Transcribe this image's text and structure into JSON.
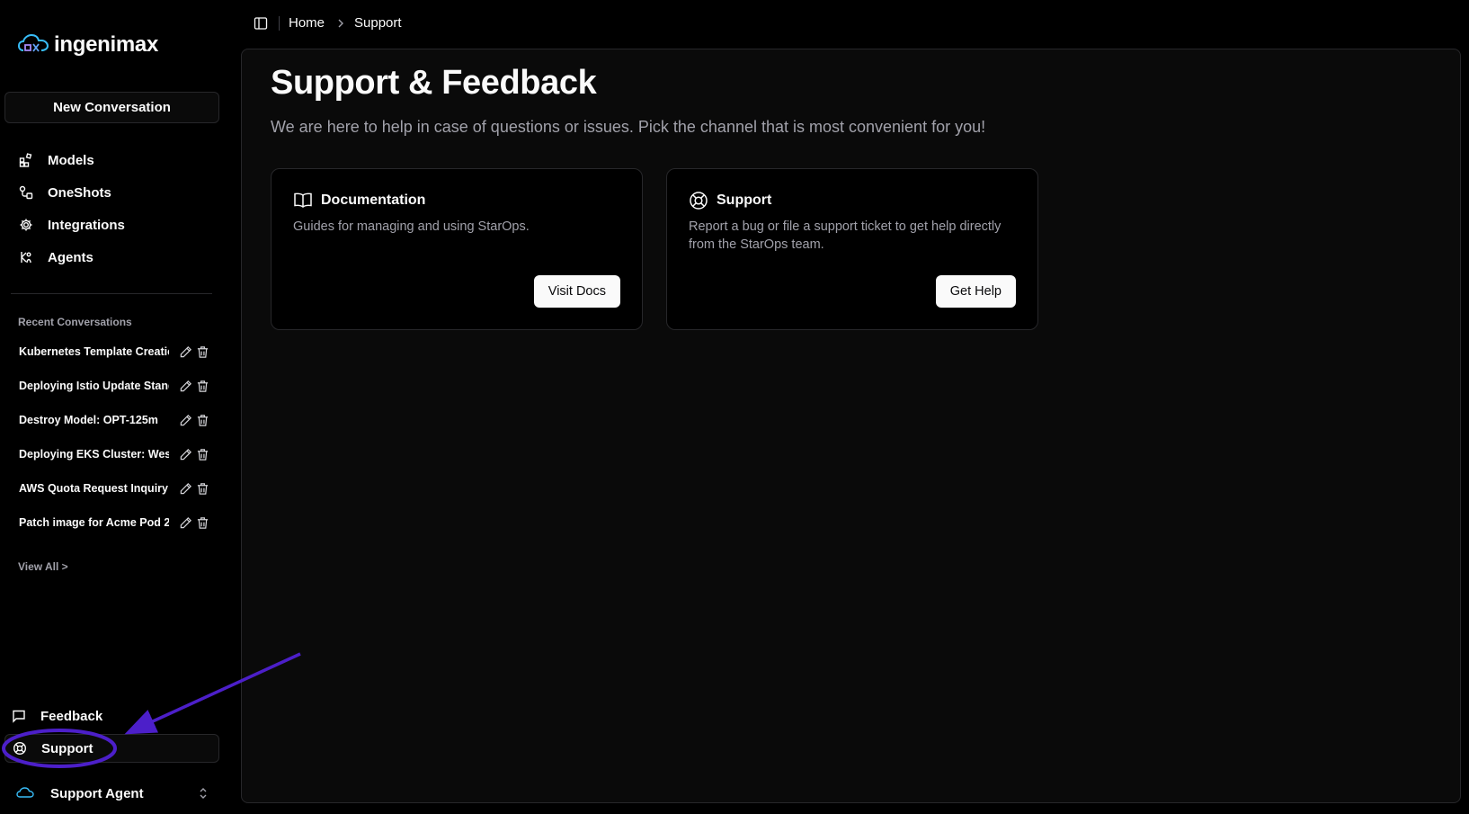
{
  "app": {
    "logo_text": "ingenimax"
  },
  "sidebar": {
    "new_conversation": "New Conversation",
    "nav": [
      {
        "label": "Models",
        "icon": "models-icon"
      },
      {
        "label": "OneShots",
        "icon": "oneshots-icon"
      },
      {
        "label": "Integrations",
        "icon": "gear-icon"
      },
      {
        "label": "Agents",
        "icon": "agents-icon"
      }
    ],
    "recent_title": "Recent Conversations",
    "recent": [
      "Kubernetes Template Creation",
      "Deploying Istio Update Standard",
      "Destroy Model: OPT-125m",
      "Deploying EKS Cluster: West",
      "AWS Quota Request Inquiry",
      "Patch image for Acme Pod 2"
    ],
    "view_all": "View All >",
    "feedback": "Feedback",
    "support": "Support",
    "user": "Support Agent"
  },
  "topbar": {
    "breadcrumb_home": "Home",
    "breadcrumb_current": "Support"
  },
  "main": {
    "title": "Support & Feedback",
    "subtitle": "We are here to help in case of questions or issues. Pick the channel that is most convenient for you!",
    "cards": [
      {
        "title": "Documentation",
        "description": "Guides for managing and using StarOps.",
        "button": "Visit Docs",
        "icon": "book-icon"
      },
      {
        "title": "Support",
        "description": "Report a bug or file a support ticket to get help directly from the StarOps team.",
        "button": "Get Help",
        "icon": "lifebuoy-icon"
      }
    ]
  },
  "colors": {
    "background": "#000000",
    "panel": "#0a0a0a",
    "border": "#27272a",
    "muted_text": "#a1a1aa",
    "annotation": "#4c1fc9"
  }
}
